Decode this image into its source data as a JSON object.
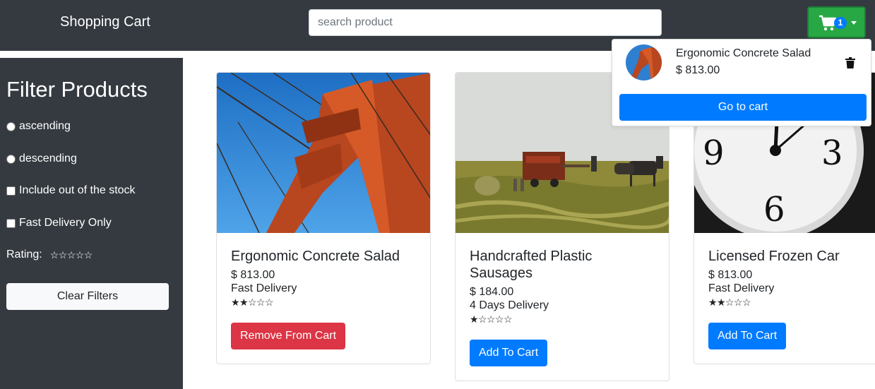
{
  "header": {
    "brand": "Shopping Cart",
    "search_placeholder": "search product",
    "cart_count": "1"
  },
  "filters": {
    "title": "Filter Products",
    "ascending": "ascending",
    "descending": "descending",
    "include_out_of_stock": "Include out of the stock",
    "fast_delivery_only": "Fast Delivery Only",
    "rating_label": "Rating:",
    "rating_value": 0,
    "clear_label": "Clear Filters"
  },
  "products": [
    {
      "name": "Ergonomic Concrete Salad",
      "price": "$ 813.00",
      "delivery": "Fast Delivery",
      "rating": 2,
      "button_label": "Remove From Cart"
    },
    {
      "name": "Handcrafted Plastic Sausages",
      "price": "$ 184.00",
      "delivery": "4 Days Delivery",
      "rating": 1,
      "button_label": "Add To Cart"
    },
    {
      "name": "Licensed Frozen Car",
      "price": "$ 813.00",
      "delivery": "Fast Delivery",
      "rating": 2,
      "button_label": "Add To Cart"
    }
  ],
  "cart_dropdown": {
    "item_name": "Ergonomic Concrete Salad",
    "item_price": "$ 813.00",
    "goto_label": "Go to cart"
  },
  "colors": {
    "navbar": "#343a40",
    "cart_button": "#28a745",
    "primary": "#007bff",
    "danger": "#dc3545"
  },
  "icons": [
    "cart-icon",
    "trash-icon",
    "star-filled-icon",
    "star-empty-icon",
    "chevron-down-icon"
  ]
}
